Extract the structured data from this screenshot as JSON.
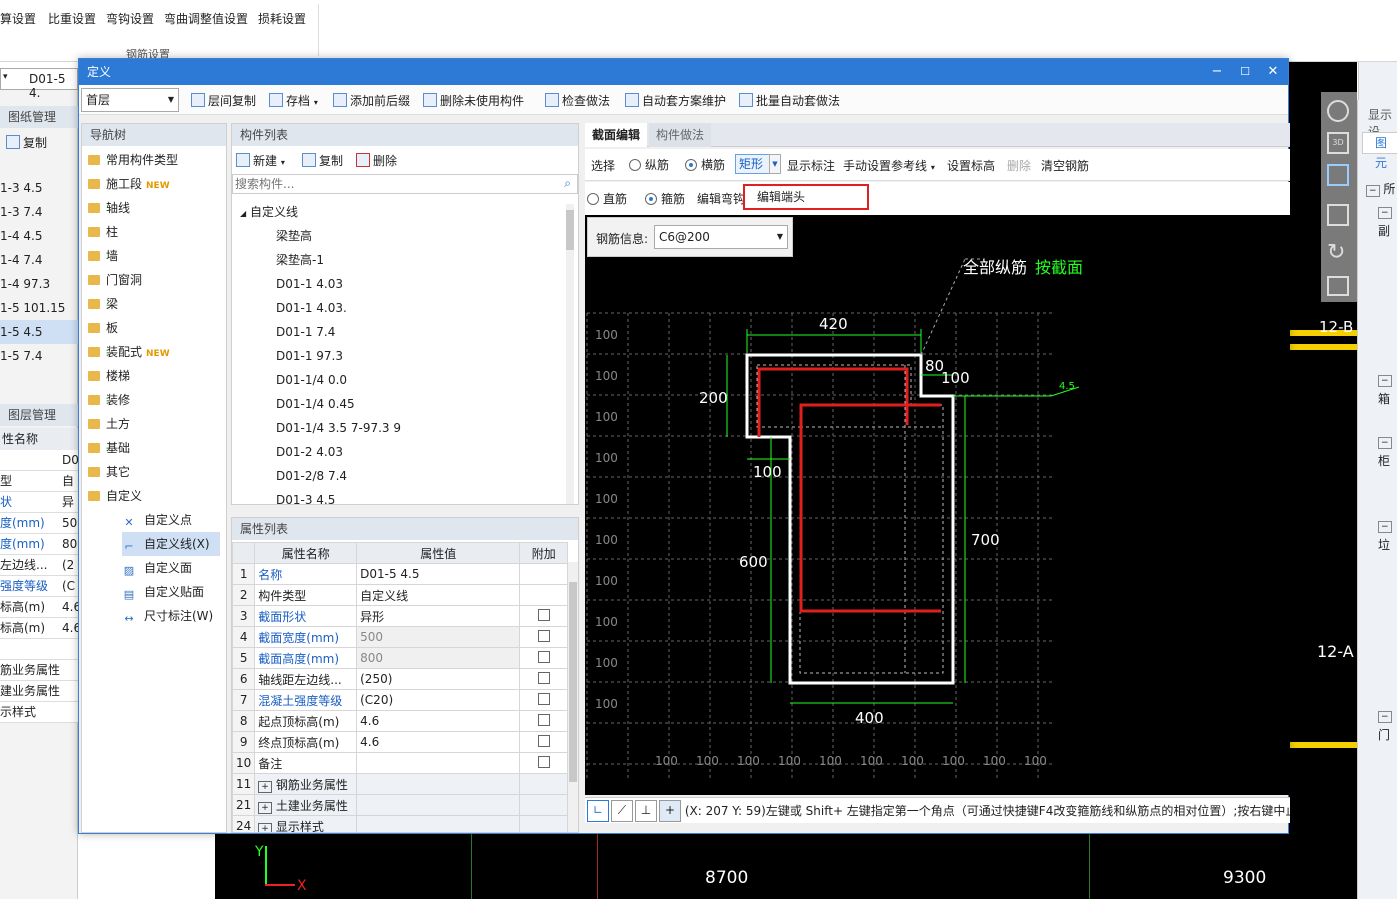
{
  "ribbon": {
    "items": [
      "算设置",
      "比重设置",
      "弯钩设置",
      "弯曲调整值设置",
      "损耗设置"
    ],
    "group": "钢筋设置"
  },
  "bg": {
    "combo": "D01-5 4.",
    "drawing_panel": "图纸管理",
    "copy": "复制",
    "drawings": [
      "1-3 4.5",
      "1-3 7.4",
      "1-4 4.5",
      "1-4 7.4",
      "1-4 97.3",
      "1-5 101.15",
      "1-5 4.5",
      "1-5 7.4"
    ],
    "layer_panel": "图层管理",
    "prop_header": "性名称",
    "prop_rows": [
      [
        "",
        "D0"
      ],
      [
        "型",
        "自"
      ],
      [
        "状",
        "异"
      ],
      [
        "度(mm)",
        "50"
      ],
      [
        "度(mm)",
        "80"
      ],
      [
        "左边线...",
        "(2"
      ],
      [
        "强度等级",
        "(C"
      ],
      [
        "标高(m)",
        "4.6"
      ],
      [
        "标高(m)",
        "4.6"
      ],
      [
        "",
        ""
      ],
      [
        "筋业务属性",
        ""
      ],
      [
        "建业务属性",
        ""
      ],
      [
        "示样式",
        ""
      ]
    ],
    "right_top": "显示设",
    "right_tab": "图元",
    "right_items": [
      "所",
      "副",
      "",
      "箱",
      "柜",
      "垃",
      "门"
    ],
    "axis_labels": [
      "12-B",
      "12-A"
    ],
    "dims": [
      "8700",
      "9300"
    ]
  },
  "dialog": {
    "title": "定义",
    "controls": {
      "min": "−",
      "max": "☐",
      "close": "✕"
    },
    "floor": "首层",
    "toolbar": [
      "层间复制",
      "存档",
      "添加前后缀",
      "删除未使用构件",
      "检查做法",
      "自动套方案维护",
      "批量自动套做法"
    ],
    "nav": {
      "header": "导航树",
      "items": [
        {
          "label": "常用构件类型",
          "new": ""
        },
        {
          "label": "施工段",
          "new": "NEW"
        },
        {
          "label": "轴线",
          "new": ""
        },
        {
          "label": "柱",
          "new": ""
        },
        {
          "label": "墙",
          "new": ""
        },
        {
          "label": "门窗洞",
          "new": ""
        },
        {
          "label": "梁",
          "new": ""
        },
        {
          "label": "板",
          "new": ""
        },
        {
          "label": "装配式",
          "new": "NEW"
        },
        {
          "label": "楼梯",
          "new": ""
        },
        {
          "label": "装修",
          "new": ""
        },
        {
          "label": "土方",
          "new": ""
        },
        {
          "label": "基础",
          "new": ""
        },
        {
          "label": "其它",
          "new": ""
        },
        {
          "label": "自定义",
          "new": ""
        }
      ],
      "sub": [
        {
          "icon": "✕",
          "label": "自定义点"
        },
        {
          "icon": "⌐",
          "label": "自定义线(X)"
        },
        {
          "icon": "▨",
          "label": "自定义面"
        },
        {
          "icon": "▤",
          "label": "自定义贴面"
        },
        {
          "icon": "↔",
          "label": "尺寸标注(W)"
        }
      ]
    },
    "comp": {
      "header": "构件列表",
      "new": "新建",
      "copy": "复制",
      "delete": "删除",
      "search_placeholder": "搜索构件...",
      "group": "自定义线",
      "items": [
        "梁垫高",
        "梁垫高-1",
        "D01-1 4.03",
        "D01-1 4.03.",
        "D01-1 7.4",
        "D01-1 97.3",
        "D01-1/4 0.0",
        "D01-1/4 0.45",
        "D01-1/4 3.5 7-97.3 9",
        "D01-2 4.03",
        "D01-2/8 7.4",
        "D01-3 4.5"
      ]
    },
    "props": {
      "header": "属性列表",
      "cols": [
        "属性名称",
        "属性值",
        "附加"
      ],
      "rows": [
        {
          "no": "1",
          "name": "名称",
          "value": "D01-5 4.5",
          "blue": true,
          "chk": false
        },
        {
          "no": "2",
          "name": "构件类型",
          "value": "自定义线",
          "blue": false,
          "chk": false
        },
        {
          "no": "3",
          "name": "截面形状",
          "value": "异形",
          "blue": true,
          "chk": true
        },
        {
          "no": "4",
          "name": "截面宽度(mm)",
          "value": "500",
          "blue": true,
          "chk": true,
          "grey": true
        },
        {
          "no": "5",
          "name": "截面高度(mm)",
          "value": "800",
          "blue": true,
          "chk": true,
          "grey": true
        },
        {
          "no": "6",
          "name": "轴线距左边线...",
          "value": "(250)",
          "blue": false,
          "chk": true
        },
        {
          "no": "7",
          "name": "混凝土强度等级",
          "value": "(C20)",
          "blue": true,
          "chk": true
        },
        {
          "no": "8",
          "name": "起点顶标高(m)",
          "value": "4.6",
          "blue": false,
          "chk": true
        },
        {
          "no": "9",
          "name": "终点顶标高(m)",
          "value": "4.6",
          "blue": false,
          "chk": true
        },
        {
          "no": "10",
          "name": "备注",
          "value": "",
          "blue": false,
          "chk": true
        },
        {
          "no": "11",
          "name": "钢筋业务属性",
          "value": "",
          "blue": false,
          "chk": false,
          "expand": true
        },
        {
          "no": "21",
          "name": "土建业务属性",
          "value": "",
          "blue": false,
          "chk": false,
          "expand": true
        },
        {
          "no": "24",
          "name": "显示样式",
          "value": "",
          "blue": false,
          "chk": false,
          "expand": true
        }
      ]
    },
    "editor": {
      "tabs": [
        "截面编辑",
        "构件做法"
      ],
      "row1": {
        "select": "选择",
        "long": "纵筋",
        "hoop": "横筋",
        "shape": "矩形",
        "show_label": "显示标注",
        "manual_ref": "手动设置参考线",
        "set_elev": "设置标高",
        "delete": "删除",
        "clear": "清空钢筋"
      },
      "row2": {
        "straight": "直筋",
        "stirrup": "箍筋",
        "edit_hook": "编辑弯钩",
        "edit_end": "编辑端头"
      },
      "rebar_info_label": "钢筋信息:",
      "rebar_info_value": "C6@200",
      "annotation_a": "全部纵筋",
      "annotation_b": "按截面",
      "dims": {
        "d420": "420",
        "d80": "80",
        "d100a": "100",
        "d200": "200",
        "d100b": "100",
        "d600": "600",
        "d700": "700",
        "d400": "400",
        "d45": "4.5"
      },
      "grid_label": "100",
      "status": "(X: 207 Y: 59)左键或 Shift+ 左键指定第一个角点（可通过快捷键F4改变箍筋线和纵筋点的相对位置）;按右键中止"
    }
  }
}
